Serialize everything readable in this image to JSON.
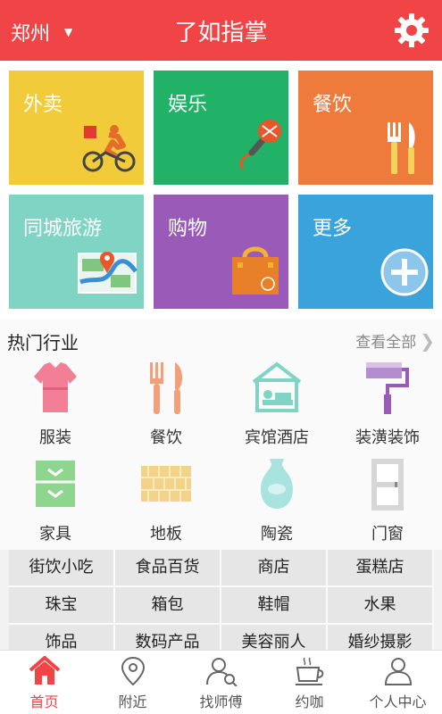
{
  "header": {
    "city": "郑州",
    "caret": "▼",
    "title": "了如指掌",
    "settings_icon": "gear-icon",
    "color": "#f04447"
  },
  "tiles": [
    {
      "label": "外卖",
      "icon": "delivery-rider-icon",
      "color": "#f2cb3a"
    },
    {
      "label": "娱乐",
      "icon": "microphone-icon",
      "color": "#22b267"
    },
    {
      "label": "餐饮",
      "icon": "fork-knife-icon",
      "color": "#ee7a3c"
    },
    {
      "label": "同城旅游",
      "icon": "map-pin-icon",
      "color": "#7fd4c4"
    },
    {
      "label": "购物",
      "icon": "shopping-bag-icon",
      "color": "#9a5bb8"
    },
    {
      "label": "更多",
      "icon": "plus-circle-icon",
      "color": "#3aa3dc"
    }
  ],
  "hot": {
    "title": "热门行业",
    "view_all": "查看全部",
    "chevron": "❯",
    "categories": [
      {
        "label": "服装",
        "icon": "dress-icon"
      },
      {
        "label": "餐饮",
        "icon": "fork-knife-icon"
      },
      {
        "label": "宾馆酒店",
        "icon": "hotel-bed-icon"
      },
      {
        "label": "装潢装饰",
        "icon": "paint-roller-icon"
      },
      {
        "label": "家具",
        "icon": "drawer-cabinet-icon"
      },
      {
        "label": "地板",
        "icon": "wood-floor-icon"
      },
      {
        "label": "陶瓷",
        "icon": "vase-icon"
      },
      {
        "label": "门窗",
        "icon": "door-icon"
      }
    ]
  },
  "tags": [
    "街饮小吃",
    "食品百货",
    "商店",
    "蛋糕店",
    "珠宝",
    "箱包",
    "鞋帽",
    "水果",
    "饰品",
    "数码产品",
    "美容丽人",
    "婚纱摄影"
  ],
  "nav": [
    {
      "label": "首页",
      "icon": "home-icon",
      "active": true
    },
    {
      "label": "附近",
      "icon": "location-pin-icon",
      "active": false
    },
    {
      "label": "找师傅",
      "icon": "user-search-icon",
      "active": false
    },
    {
      "label": "约咖",
      "icon": "coffee-cup-icon",
      "active": false
    },
    {
      "label": "个人中心",
      "icon": "person-icon",
      "active": false
    }
  ]
}
